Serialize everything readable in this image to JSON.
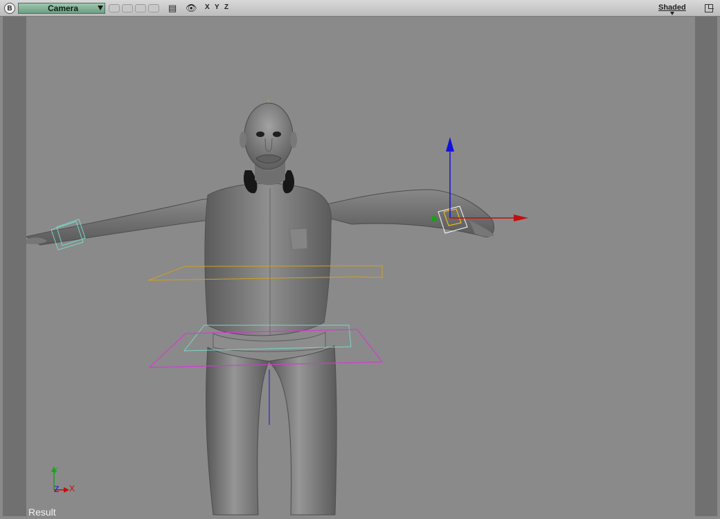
{
  "toolbar": {
    "view_badge": "B",
    "camera": "Camera",
    "axes": [
      "X",
      "Y",
      "Z"
    ],
    "shading": "Shaded"
  },
  "viewport": {
    "status_label": "Result",
    "axis_triad": {
      "y": "Y",
      "z": "Z",
      "x": "X"
    }
  },
  "colors": {
    "toolbar_bg": "#d0d0d0",
    "camera_field": "#8fbf9f",
    "viewport_bg": "#8a8a8a",
    "x_axis": "#e01010",
    "y_axis": "#18a018",
    "z_axis": "#1111dd",
    "orange_guide": "#d2a01c",
    "cyan_guide": "#7ad6c8",
    "magenta_guide": "#d23bd2"
  },
  "icons": [
    "view-badge-icon",
    "dropdown-arrow-icon",
    "camera-icon",
    "eye-icon",
    "maximize-icon"
  ]
}
